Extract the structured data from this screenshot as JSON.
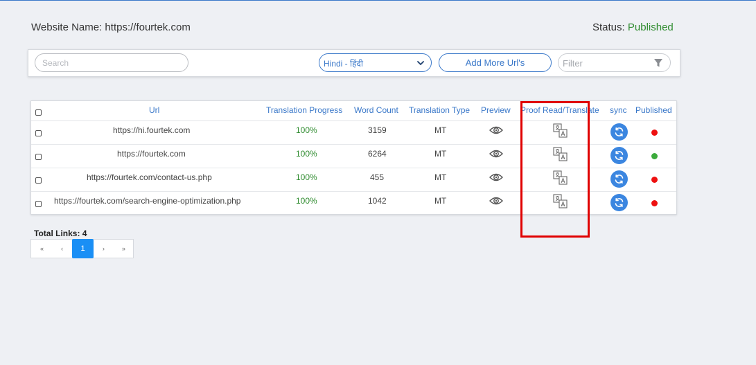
{
  "header": {
    "website_label": "Website Name: https://fourtek.com",
    "status_label": "Status:",
    "status_value": "Published"
  },
  "toolbar": {
    "search_placeholder": "Search",
    "language": "Hindi - हिंदी",
    "add_button": "Add More Url's",
    "filter_placeholder": "Filter"
  },
  "table": {
    "columns": [
      "Url",
      "Translation Progress",
      "Word Count",
      "Translation Type",
      "Preview",
      "Proof Read/Translate",
      "sync",
      "Published"
    ],
    "rows": [
      {
        "url": "https://hi.fourtek.com",
        "progress": "100%",
        "word_count": "3159",
        "type": "MT",
        "published_color": "#ee1111"
      },
      {
        "url": "https://fourtek.com",
        "progress": "100%",
        "word_count": "6264",
        "type": "MT",
        "published_color": "#3cab3c"
      },
      {
        "url": "https://fourtek.com/contact-us.php",
        "progress": "100%",
        "word_count": "455",
        "type": "MT",
        "published_color": "#ee1111"
      },
      {
        "url": "https://fourtek.com/search-engine-optimization.php",
        "progress": "100%",
        "word_count": "1042",
        "type": "MT",
        "published_color": "#ee1111"
      }
    ]
  },
  "footer": {
    "total_links": "Total Links: 4",
    "pager": {
      "first": "«",
      "prev": "‹",
      "current": "1",
      "next": "›",
      "last": "»"
    }
  },
  "icons": {
    "preview": "eye-icon",
    "proof_read": "translate-icon",
    "sync": "sync-icon",
    "dropdown": "chevron-down-icon",
    "filter": "funnel-icon"
  },
  "colors": {
    "accent": "#3a78c9",
    "published_green": "#2e8b2e",
    "highlight_box": "#e00000",
    "sync_button": "#3b86e0",
    "pager_active": "#1a8ff5"
  }
}
